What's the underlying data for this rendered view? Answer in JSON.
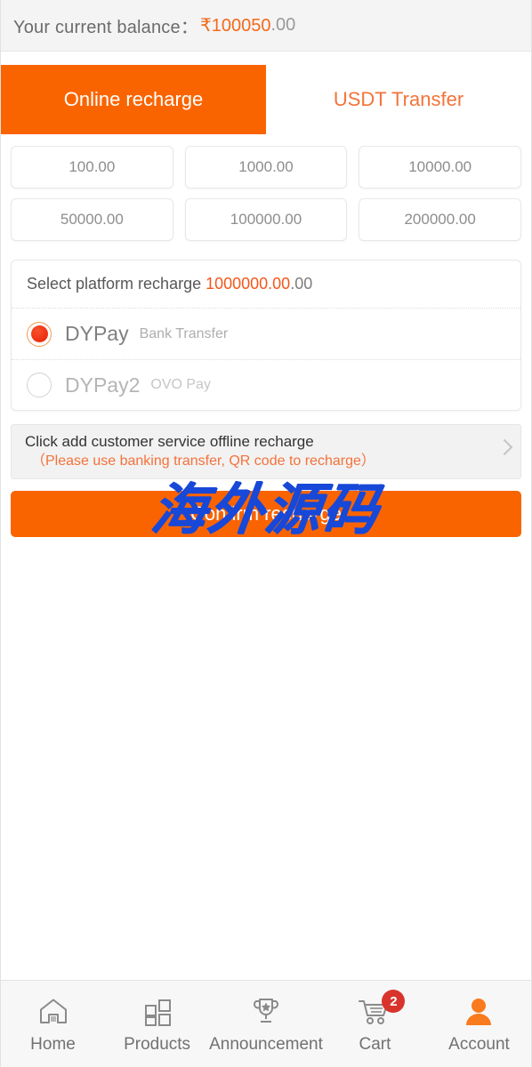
{
  "balance": {
    "label": "Your current balance：",
    "amount": "₹100050",
    "cents": ".00"
  },
  "tabs": [
    {
      "label": "Online recharge",
      "active": true
    },
    {
      "label": "USDT Transfer",
      "active": false
    }
  ],
  "amount_presets": [
    "100.00",
    "1000.00",
    "10000.00",
    "50000.00",
    "100000.00",
    "200000.00"
  ],
  "platform": {
    "heading": "Select platform recharge",
    "heading_amount": "1000000.00",
    "heading_cents": ".00",
    "methods": [
      {
        "name": "DYPay",
        "desc": "Bank Transfer",
        "selected": true
      },
      {
        "name": "DYPay2",
        "desc": "OVO Pay",
        "selected": false
      }
    ]
  },
  "offline": {
    "line1": "Click add customer service offline recharge",
    "line2": "（Please use banking transfer, QR code to recharge）",
    "chevron": "chevron-right-icon"
  },
  "confirm_button": "Confirm recharge",
  "watermark": "海外源码",
  "bottom_nav": [
    {
      "label": "Home",
      "icon": "home-icon",
      "active": false,
      "badge": ""
    },
    {
      "label": "Products",
      "icon": "grid-icon",
      "active": false,
      "badge": ""
    },
    {
      "label": "Announcement",
      "icon": "trophy-icon",
      "active": false,
      "badge": ""
    },
    {
      "label": "Cart",
      "icon": "cart-icon",
      "active": false,
      "badge": "2"
    },
    {
      "label": "Account",
      "icon": "user-icon",
      "active": true,
      "badge": ""
    }
  ],
  "colors": {
    "accent_orange": "#fa6400",
    "text_orange": "#f4713a",
    "badge_red": "#d8342c",
    "watermark_blue": "#1748d8",
    "grey_text": "#8d8d8d"
  }
}
